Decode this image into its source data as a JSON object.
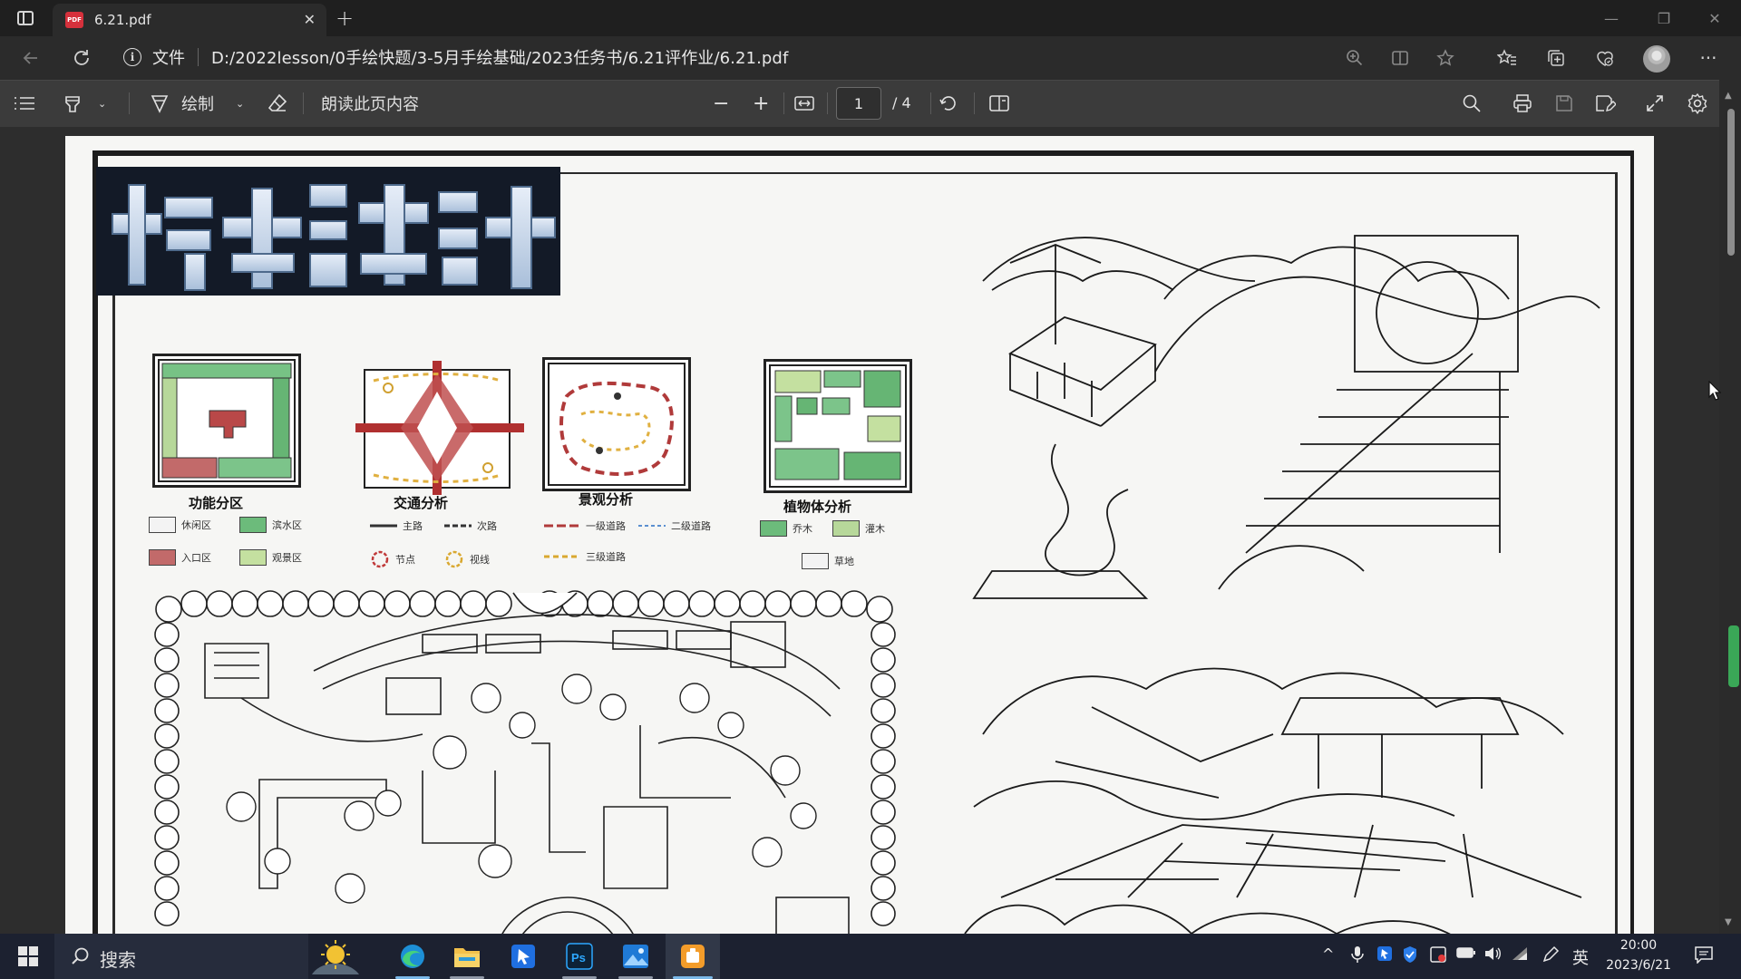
{
  "tab": {
    "badge": "PDF",
    "title": "6.21.pdf",
    "close": "✕",
    "new": "+"
  },
  "window": {
    "minimize": "—",
    "restore": "❐",
    "close": "✕"
  },
  "address": {
    "scheme": "文件",
    "url": "D:/2022lesson/0手绘快题/3-5月手绘基础/2023任务书/6.21评作业/6.21.pdf"
  },
  "pdf_toolbar": {
    "draw_label": "绘制",
    "read_aloud": "朗读此页内容",
    "zoom_out": "−",
    "zoom_in": "+",
    "page_current": "1",
    "page_total": "/ 4"
  },
  "document": {
    "diagrams": [
      {
        "label": "功能分区",
        "legend": [
          "休闲区",
          "滨水区",
          "入口区",
          "观景区"
        ]
      },
      {
        "label": "交通分析",
        "legend": [
          "主路",
          "次路",
          "节点",
          "视线"
        ]
      },
      {
        "label": "景观分析",
        "legend": [
          "一级道路",
          "二级道路",
          "三级道路"
        ]
      },
      {
        "label": "植物体分析",
        "legend": [
          "乔木",
          "灌木",
          "草地"
        ]
      }
    ]
  },
  "taskbar": {
    "search": "搜索",
    "ime": "英",
    "time": "20:00",
    "date": "2023/6/21"
  },
  "colors": {
    "accent_green": "#3aa757",
    "pdf_red": "#d6313c",
    "taskbar_bg": "#1c2130",
    "toolbar_bg": "#3b3b3b"
  }
}
